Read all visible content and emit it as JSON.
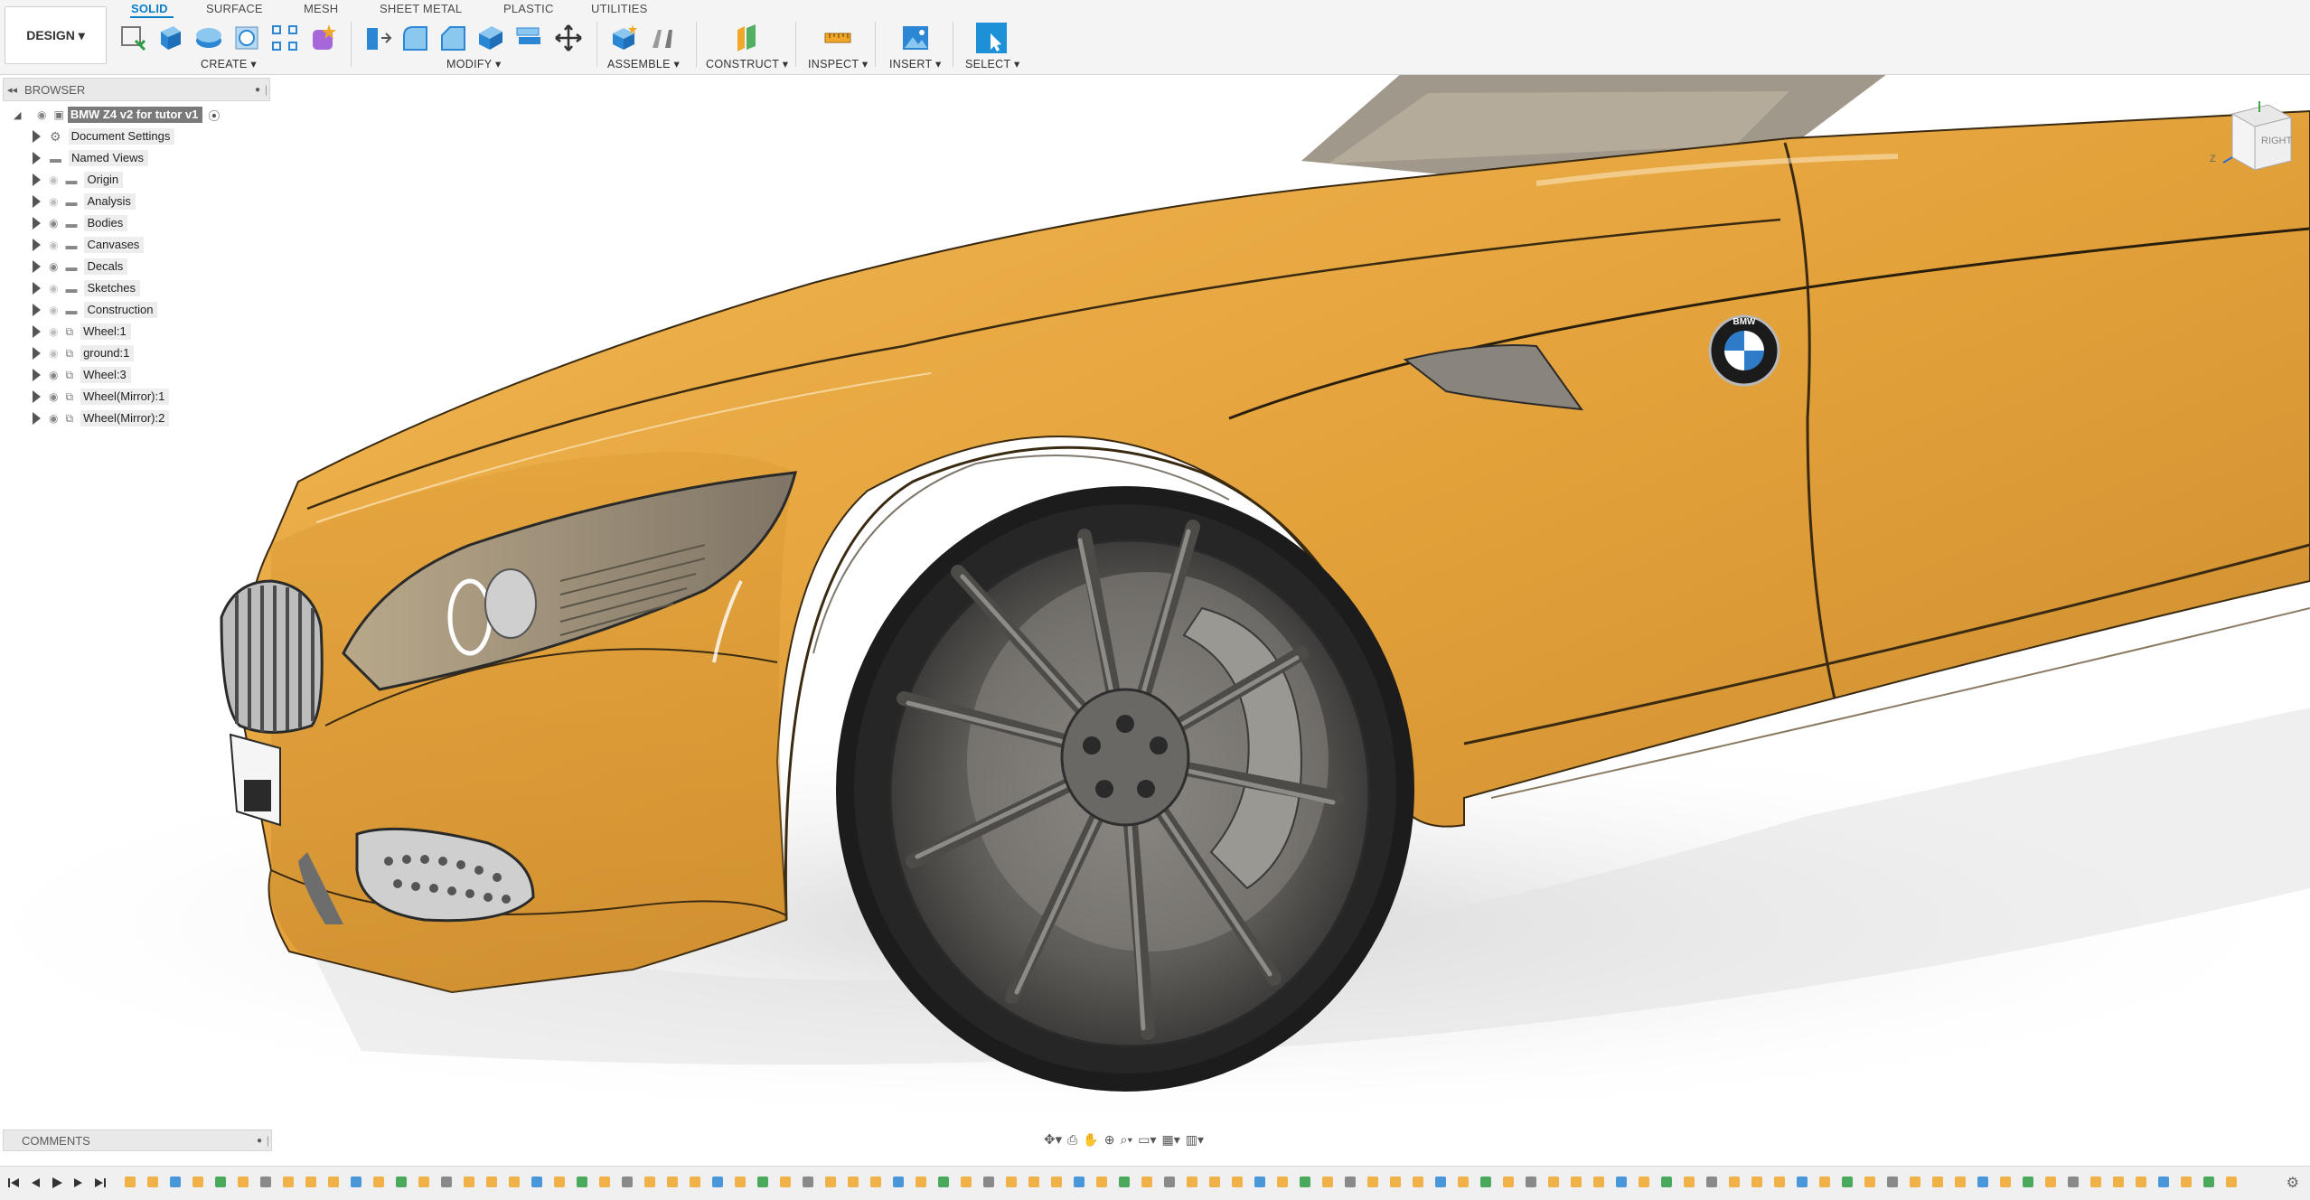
{
  "toolbar": {
    "workspace": "DESIGN ▾",
    "tabs": [
      {
        "label": "SOLID",
        "active": true
      },
      {
        "label": "SURFACE",
        "active": false
      },
      {
        "label": "MESH",
        "active": false
      },
      {
        "label": "SHEET METAL",
        "active": false
      },
      {
        "label": "PLASTIC",
        "active": false
      },
      {
        "label": "UTILITIES",
        "active": false
      }
    ],
    "groups": [
      {
        "label": "CREATE ▾"
      },
      {
        "label": "MODIFY ▾"
      },
      {
        "label": "ASSEMBLE ▾"
      },
      {
        "label": "CONSTRUCT ▾"
      },
      {
        "label": "INSPECT ▾"
      },
      {
        "label": "INSERT ▾"
      },
      {
        "label": "SELECT ▾"
      }
    ]
  },
  "browser": {
    "title": "BROWSER",
    "root": "BMW Z4 v2 for tutor v1",
    "items": [
      {
        "label": "Document Settings",
        "icon": "gear-icon"
      },
      {
        "label": "Named Views",
        "icon": "folder-icon"
      },
      {
        "label": "Origin",
        "icon": "folder-icon"
      },
      {
        "label": "Analysis",
        "icon": "folder-icon"
      },
      {
        "label": "Bodies",
        "icon": "folder-icon"
      },
      {
        "label": "Canvases",
        "icon": "folder-icon"
      },
      {
        "label": "Decals",
        "icon": "folder-icon"
      },
      {
        "label": "Sketches",
        "icon": "folder-icon"
      },
      {
        "label": "Construction",
        "icon": "folder-icon"
      },
      {
        "label": "Wheel:1",
        "icon": "component-icon"
      },
      {
        "label": "ground:1",
        "icon": "component-icon"
      },
      {
        "label": "Wheel:3",
        "icon": "component-icon"
      },
      {
        "label": "Wheel(Mirror):1",
        "icon": "component-icon"
      },
      {
        "label": "Wheel(Mirror):2",
        "icon": "component-icon"
      }
    ]
  },
  "viewcube": {
    "face": "RIGHT",
    "axis": "Z"
  },
  "viewport": {
    "badge_text": "BMW"
  },
  "comments": {
    "title": "COMMENTS"
  },
  "colors": {
    "accent": "#0a7dc7",
    "car_paint": "#e9a53a",
    "tire": "#1c1c1c",
    "rim": "#6c6a66"
  }
}
